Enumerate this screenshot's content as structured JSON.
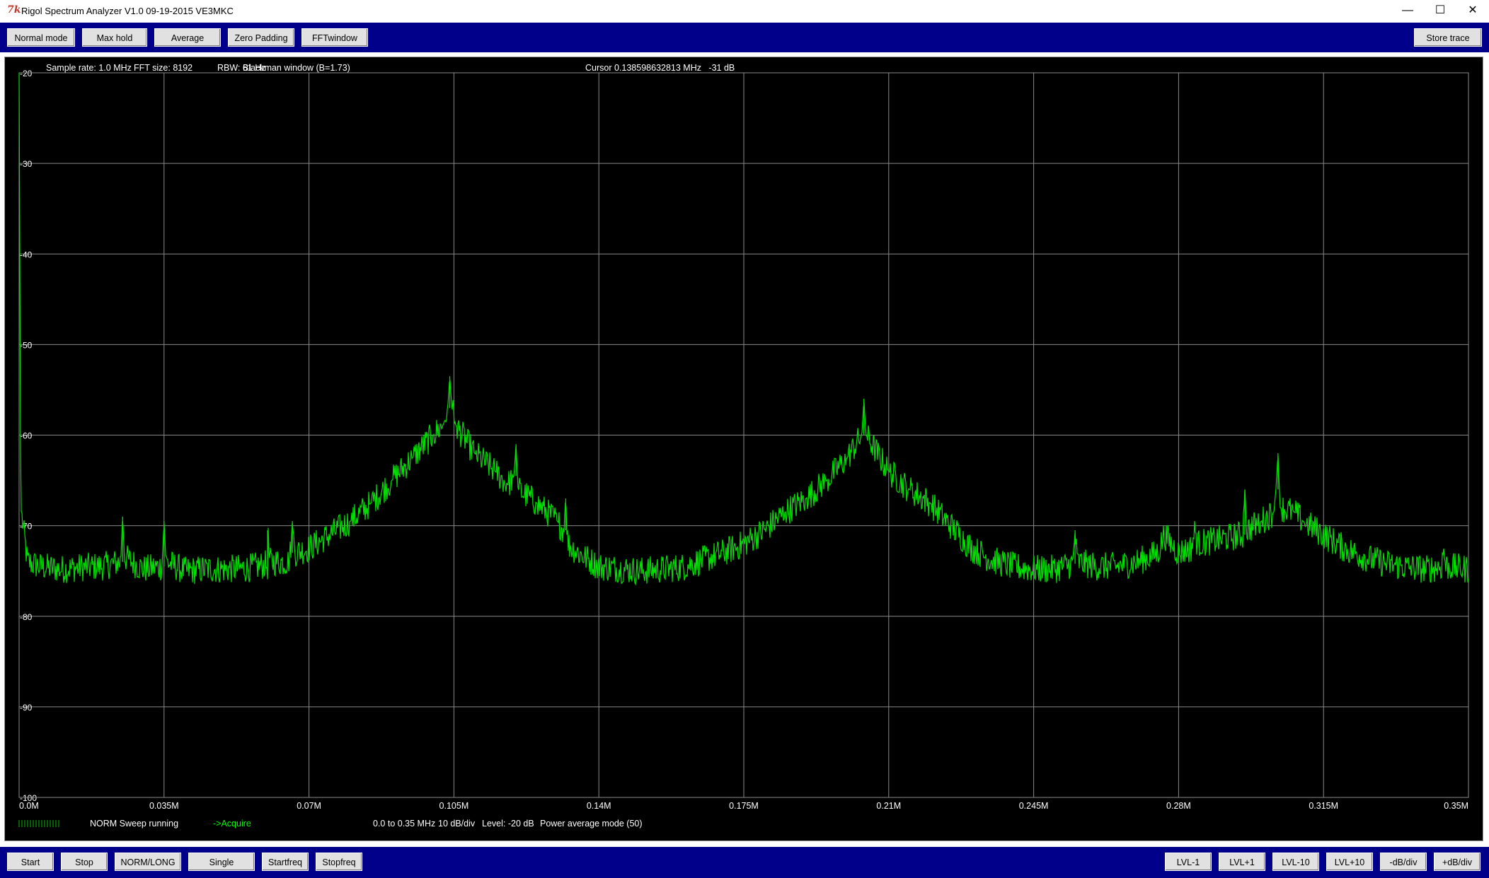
{
  "window": {
    "title": "Rigol Spectrum Analyzer V1.0 09-19-2015 VE3MKC",
    "app_icon_text": "7k",
    "minimize": "—",
    "maximize": "☐",
    "close": "✕"
  },
  "toolbar_top": {
    "normal_mode": "Normal mode",
    "max_hold": "Max hold",
    "average": "Average",
    "zero_padding": "Zero Padding",
    "fft_window": "FFTwindow",
    "store_trace": "Store trace"
  },
  "info": {
    "sample_rate": "Sample rate: 1.0 MHz",
    "fft_size": "FFT size: 8192",
    "rbw": "RBW: 61 Hz",
    "window": "Blackman window (B=1.73)",
    "cursor": "Cursor 0.138598632813 MHz   -31 dB"
  },
  "status": {
    "sweep": "NORM Sweep running",
    "acquire": "->Acquire",
    "span": "0.0 to 0.35 MHz",
    "scale": "10 dB/div",
    "level": "Level: -20 dB",
    "mode": "Power average  mode (50)"
  },
  "toolbar_bottom": {
    "start": "Start",
    "stop": "Stop",
    "norm_long": "NORM/LONG",
    "single": "Single",
    "startfreq": "Startfreq",
    "stopfreq": "Stopfreq",
    "lvl_minus_1": "LVL-1",
    "lvl_plus_1": "LVL+1",
    "lvl_minus_10": "LVL-10",
    "lvl_plus_10": "LVL+10",
    "minus_db_div": "-dB/div",
    "plus_db_div": "+dB/div"
  },
  "colors": {
    "toolbar": "#00008b",
    "plot_background": "#000000",
    "grid": "#8a8a8a",
    "trace": "#00e000",
    "acquire_text": "#00ff00"
  },
  "chart_data": {
    "type": "line",
    "xlabel": "",
    "ylabel": "",
    "xlim": [
      0,
      0.35
    ],
    "ylim": [
      -100,
      -20
    ],
    "x_unit": "MHz",
    "y_unit": "dB",
    "x_ticks": [
      "0.0M",
      "0.035M",
      "0.07M",
      "0.105M",
      "0.14M",
      "0.175M",
      "0.21M",
      "0.245M",
      "0.28M",
      "0.315M",
      "0.35M"
    ],
    "y_ticks": [
      "-20",
      "-30",
      "-40",
      "-50",
      "-60",
      "-70",
      "-80",
      "-90",
      "-100"
    ],
    "grid": true,
    "series": [
      {
        "points": [
          [
            0.0,
            -20
          ],
          [
            0.0004,
            -68
          ],
          [
            0.002,
            -74
          ],
          [
            0.005,
            -74.5
          ],
          [
            0.01,
            -74.8
          ],
          [
            0.015,
            -74.6
          ],
          [
            0.02,
            -74.5
          ],
          [
            0.0245,
            -74
          ],
          [
            0.025,
            -69
          ],
          [
            0.0255,
            -73.5
          ],
          [
            0.03,
            -74.8
          ],
          [
            0.0345,
            -74.5
          ],
          [
            0.035,
            -69.5
          ],
          [
            0.0355,
            -74
          ],
          [
            0.04,
            -75
          ],
          [
            0.045,
            -74.8
          ],
          [
            0.05,
            -74.8
          ],
          [
            0.055,
            -74.7
          ],
          [
            0.06,
            -74.5
          ],
          [
            0.0595,
            -74.3
          ],
          [
            0.06,
            -70.5
          ],
          [
            0.0605,
            -74
          ],
          [
            0.065,
            -74
          ],
          [
            0.0655,
            -73
          ],
          [
            0.066,
            -69.5
          ],
          [
            0.0665,
            -73
          ],
          [
            0.07,
            -72.5
          ],
          [
            0.075,
            -71
          ],
          [
            0.08,
            -69.5
          ],
          [
            0.085,
            -67.5
          ],
          [
            0.09,
            -65
          ],
          [
            0.095,
            -62.5
          ],
          [
            0.1,
            -60
          ],
          [
            0.1025,
            -58.8
          ],
          [
            0.1035,
            -57
          ],
          [
            0.104,
            -53.5
          ],
          [
            0.1045,
            -57
          ],
          [
            0.1055,
            -59
          ],
          [
            0.11,
            -62
          ],
          [
            0.115,
            -64
          ],
          [
            0.118,
            -65.5
          ],
          [
            0.1195,
            -64.5
          ],
          [
            0.12,
            -61
          ],
          [
            0.1205,
            -66
          ],
          [
            0.125,
            -67.5
          ],
          [
            0.13,
            -69.5
          ],
          [
            0.1315,
            -70.5
          ],
          [
            0.132,
            -67
          ],
          [
            0.1325,
            -72
          ],
          [
            0.135,
            -73
          ],
          [
            0.14,
            -74.5
          ],
          [
            0.15,
            -75
          ],
          [
            0.16,
            -74.6
          ],
          [
            0.165,
            -73.8
          ],
          [
            0.17,
            -73
          ],
          [
            0.175,
            -72
          ],
          [
            0.18,
            -70.5
          ],
          [
            0.185,
            -68.5
          ],
          [
            0.19,
            -67
          ],
          [
            0.195,
            -65
          ],
          [
            0.2,
            -62.5
          ],
          [
            0.2035,
            -60
          ],
          [
            0.204,
            -56
          ],
          [
            0.2045,
            -60
          ],
          [
            0.21,
            -64
          ],
          [
            0.215,
            -66
          ],
          [
            0.22,
            -67.5
          ],
          [
            0.225,
            -70
          ],
          [
            0.23,
            -72.5
          ],
          [
            0.235,
            -73.8
          ],
          [
            0.24,
            -74.5
          ],
          [
            0.245,
            -74.8
          ],
          [
            0.25,
            -74.8
          ],
          [
            0.2545,
            -74.2
          ],
          [
            0.255,
            -70.5
          ],
          [
            0.2555,
            -74
          ],
          [
            0.26,
            -74.5
          ],
          [
            0.265,
            -74.5
          ],
          [
            0.27,
            -74
          ],
          [
            0.275,
            -73
          ],
          [
            0.2765,
            -71
          ],
          [
            0.28,
            -73
          ],
          [
            0.283,
            -72.5
          ],
          [
            0.284,
            -70.5
          ],
          [
            0.2845,
            -72
          ],
          [
            0.29,
            -71.5
          ],
          [
            0.2955,
            -71
          ],
          [
            0.296,
            -66
          ],
          [
            0.2965,
            -70.5
          ],
          [
            0.3,
            -69.5
          ],
          [
            0.303,
            -68.5
          ],
          [
            0.3035,
            -66
          ],
          [
            0.304,
            -62
          ],
          [
            0.3045,
            -68
          ],
          [
            0.308,
            -68.5
          ],
          [
            0.31,
            -69.5
          ],
          [
            0.315,
            -71
          ],
          [
            0.32,
            -72.5
          ],
          [
            0.325,
            -73.5
          ],
          [
            0.33,
            -74.2
          ],
          [
            0.335,
            -74.6
          ],
          [
            0.34,
            -74.8
          ],
          [
            0.3435,
            -74.5
          ],
          [
            0.344,
            -72.5
          ],
          [
            0.3445,
            -74.5
          ],
          [
            0.35,
            -74.8
          ]
        ]
      }
    ]
  }
}
